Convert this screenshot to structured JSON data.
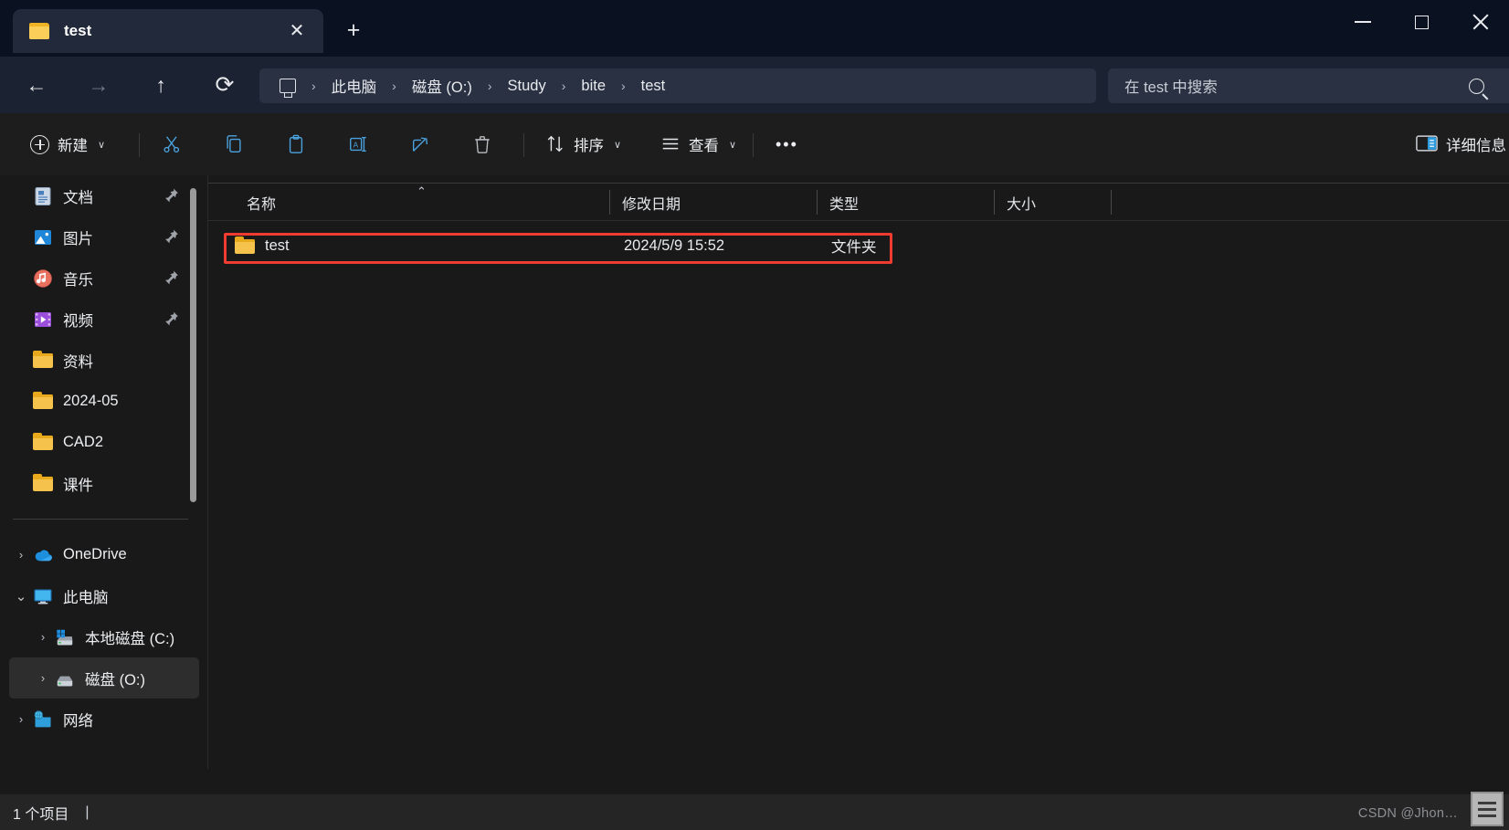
{
  "window": {
    "tab_label": "test",
    "tab_icon": "folder-icon",
    "close_label": "✕",
    "new_tab_label": "+",
    "minimize_label": "minimize",
    "maximize_label": "maximize",
    "close_window_label": "close"
  },
  "nav": {
    "back": "←",
    "forward": "→",
    "up": "↑",
    "refresh": "⟳"
  },
  "breadcrumb": {
    "root_icon": "this-pc-icon",
    "separator": "›",
    "items": [
      "此电脑",
      "磁盘 (O:)",
      "Study",
      "bite",
      "test"
    ]
  },
  "search": {
    "placeholder": "在 test 中搜索",
    "icon": "search-icon"
  },
  "toolbar": {
    "new_label": "新建",
    "chevron": "∨",
    "cut_label": "剪切",
    "copy_label": "复制",
    "paste_label": "粘贴",
    "rename_label": "重命名",
    "share_label": "共享",
    "delete_label": "删除",
    "sort_label": "排序",
    "view_label": "查看",
    "more_label": "•••",
    "details_label": "详细信息"
  },
  "sidebar": {
    "quick_items": [
      {
        "label": "文档",
        "icon": "documents-icon",
        "pinned": true
      },
      {
        "label": "图片",
        "icon": "pictures-icon",
        "pinned": true
      },
      {
        "label": "音乐",
        "icon": "music-icon",
        "pinned": true
      },
      {
        "label": "视频",
        "icon": "videos-icon",
        "pinned": true
      },
      {
        "label": "资料",
        "icon": "folder-icon",
        "pinned": false
      },
      {
        "label": "2024-05",
        "icon": "folder-icon",
        "pinned": false
      },
      {
        "label": "CAD2",
        "icon": "folder-icon",
        "pinned": false
      },
      {
        "label": "课件",
        "icon": "folder-icon",
        "pinned": false
      }
    ],
    "tree_items": [
      {
        "label": "OneDrive",
        "icon": "onedrive-icon",
        "chevron": "›",
        "expanded": false,
        "indent": 0,
        "selected": false
      },
      {
        "label": "此电脑",
        "icon": "this-pc-icon",
        "chevron": "⌄",
        "expanded": true,
        "indent": 0,
        "selected": false
      },
      {
        "label": "本地磁盘 (C:)",
        "icon": "windows-drive-icon",
        "chevron": "›",
        "expanded": false,
        "indent": 1,
        "selected": false
      },
      {
        "label": "磁盘 (O:)",
        "icon": "drive-icon",
        "chevron": "›",
        "expanded": false,
        "indent": 1,
        "selected": true
      },
      {
        "label": "网络",
        "icon": "network-icon",
        "chevron": "›",
        "expanded": false,
        "indent": 0,
        "selected": false
      }
    ]
  },
  "filelist": {
    "columns": [
      {
        "label": "名称",
        "sorted": "asc",
        "sort_caret": "⌃"
      },
      {
        "label": "修改日期",
        "sorted": "",
        "sort_caret": ""
      },
      {
        "label": "类型",
        "sorted": "",
        "sort_caret": ""
      },
      {
        "label": "大小",
        "sorted": "",
        "sort_caret": ""
      }
    ],
    "rows": [
      {
        "name": "test",
        "icon": "folder-icon",
        "modified": "2024/5/9 15:52",
        "type": "文件夹",
        "size": "",
        "highlighted": true
      }
    ]
  },
  "status": {
    "item_count": "1 个项目",
    "caret": "|"
  },
  "watermark": {
    "text": "CSDN @Jhon…"
  },
  "colors": {
    "titlebar": "#0a1222",
    "navbar": "#1b2231",
    "content": "#191919",
    "accent_highlight": "#f03c30",
    "folder_yellow": "#f5c24c",
    "icon_blue": "#4aa3e0"
  }
}
